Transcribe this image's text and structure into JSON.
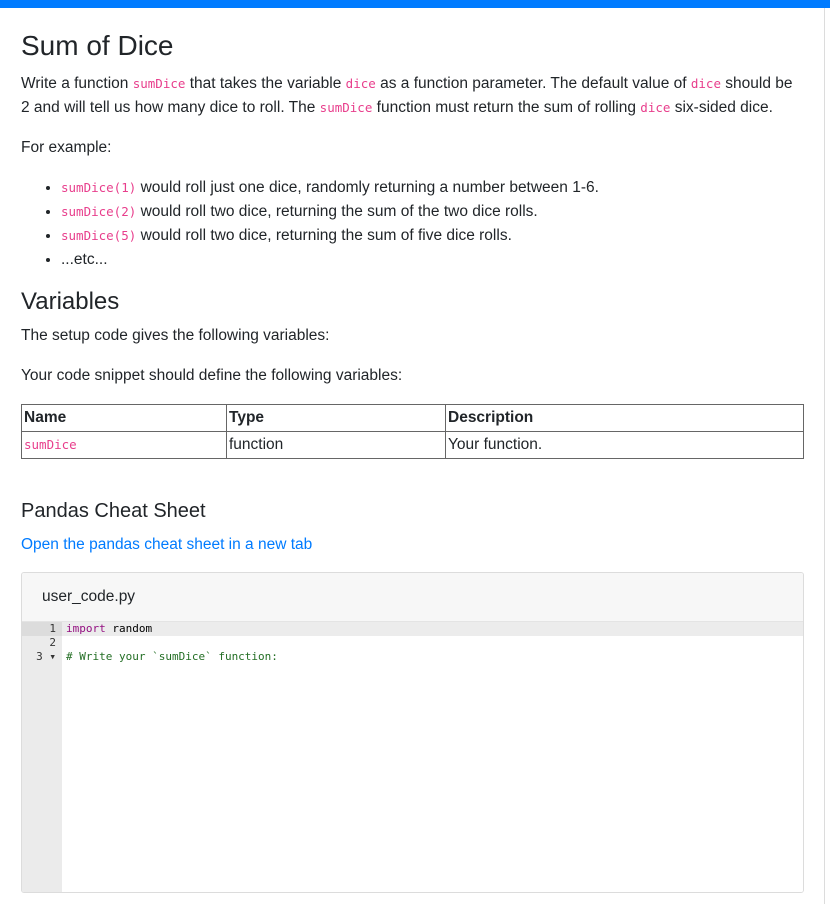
{
  "title": "Sum of Dice",
  "intro": {
    "t1": "Write a function ",
    "c1": "sumDice",
    "t2": " that takes the variable ",
    "c2": "dice",
    "t3": " as a function parameter. The default value of ",
    "c3": "dice",
    "t4": " should be 2 and will tell us how many dice to roll. The ",
    "c4": "sumDice",
    "t5": " function must return the sum of rolling ",
    "c5": "dice",
    "t6": " six-sided dice."
  },
  "example_label": "For example:",
  "examples": [
    {
      "code": "sumDice(1)",
      "text": " would roll just one dice, randomly returning a number between 1-6."
    },
    {
      "code": "sumDice(2)",
      "text": " would roll two dice, returning the sum of the two dice rolls."
    },
    {
      "code": "sumDice(5)",
      "text": " would roll two dice, returning the sum of five dice rolls."
    },
    {
      "code": "",
      "text": "...etc..."
    }
  ],
  "variables_heading": "Variables",
  "setup_text": "The setup code gives the following variables:",
  "define_text": "Your code snippet should define the following variables:",
  "table": {
    "headers": [
      "Name",
      "Type",
      "Description"
    ],
    "rows": [
      {
        "name": "sumDice",
        "type": "function",
        "description": "Your function."
      }
    ]
  },
  "cheat_heading": "Pandas Cheat Sheet",
  "cheat_link": "Open the pandas cheat sheet in a new tab",
  "editor": {
    "filename": "user_code.py",
    "line_numbers": [
      "1",
      "2",
      "3 ▾"
    ],
    "lines": {
      "l1_kw": "import",
      "l1_rest": " random",
      "l2": "",
      "l3": "# Write your `sumDice` function:"
    }
  },
  "colors": {
    "accent": "#007bff",
    "code": "#e83e8c",
    "keyword": "#930f80",
    "comment": "#236e24"
  }
}
